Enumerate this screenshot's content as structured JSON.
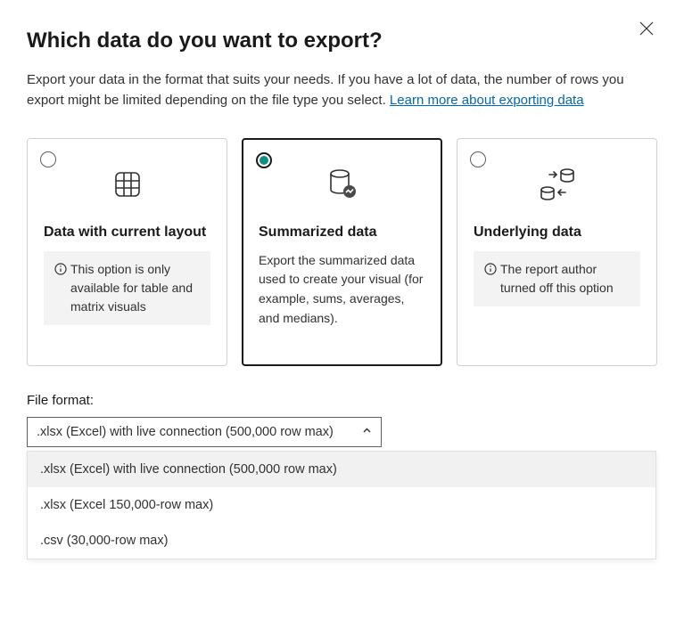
{
  "title": "Which data do you want to export?",
  "description_part1": "Export your data in the format that suits your needs. If you have a lot of data, the number of rows you export might be limited depending on the file type you select.  ",
  "learn_more_label": "Learn more about exporting data",
  "cards": {
    "layout": {
      "title": "Data with current layout",
      "note": "This option is only available for table and matrix visuals"
    },
    "summarized": {
      "title": "Summarized data",
      "desc": "Export the summarized data used to create your visual (for example, sums, averages, and medians)."
    },
    "underlying": {
      "title": "Underlying data",
      "note": "The report author turned off this option"
    }
  },
  "format_label": "File format:",
  "select_value": ".xlsx (Excel) with live connection (500,000 row max)",
  "dropdown_options": {
    "opt0": ".xlsx (Excel) with live connection (500,000 row max)",
    "opt1": ".xlsx (Excel 150,000-row max)",
    "opt2": ".csv (30,000-row max)"
  }
}
